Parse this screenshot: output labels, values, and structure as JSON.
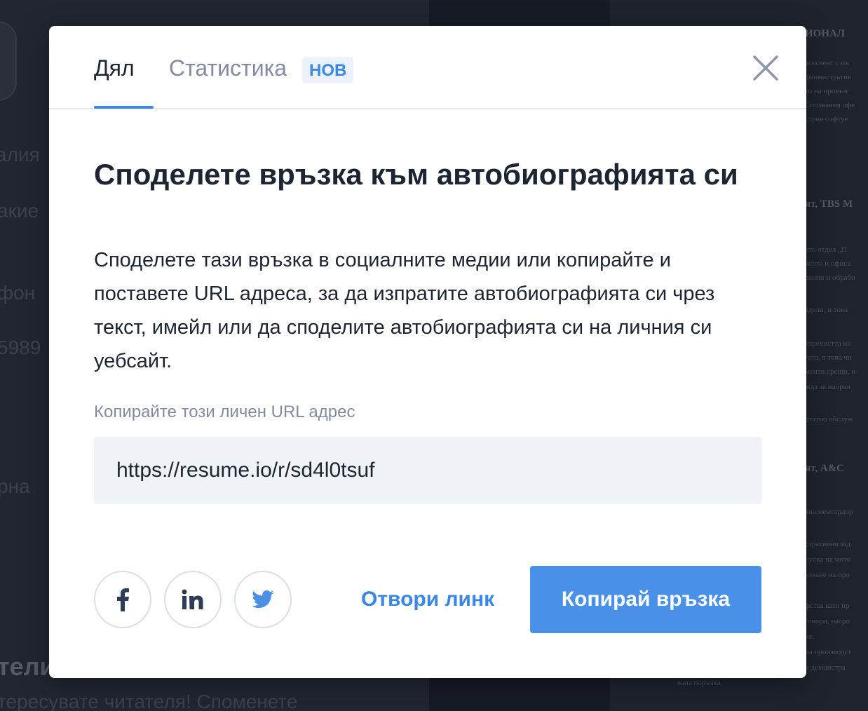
{
  "background": {
    "left_texts": [
      "алия",
      "акие",
      "фон",
      "5989",
      "рна",
      "тели",
      "тересувате читателя! Споменете"
    ],
    "doc_heads": [
      "ИОНАЛ",
      "ят, TBS M",
      "ят, A&C"
    ],
    "doc_lines": [
      "асистент с пъ",
      "дминистратив",
      "то на провъзг",
      "Сполвания офе",
      "стрия софтуе",
      "ото отдел „П",
      "всото и офиса",
      "ванни и обрабо",
      "адели, и това",
      "изреността на",
      "гата, в това чи",
      "менти срещи, и",
      "жда за направ",
      "лтатно обслуж",
      "яна ментордор",
      "стративни зад",
      "пуска на мото",
      "ъзване на про",
      "фства като пр",
      "говори, насро",
      "ие.",
      "на производст",
      "и демонстра",
      "",
      "вана поръчка."
    ]
  },
  "tabs": {
    "share_label": "Дял",
    "stats_label": "Статистика",
    "new_badge": "НОВ"
  },
  "content": {
    "title": "Споделете връзка към автобиографията си",
    "description": "Споделете тази връзка в социалните медии или копирайте и поставете URL адреса, за да изпратите автобиографията си чрез текст, имейл или да споделите автобиографията си на личния си уебсайт.",
    "url_label": "Копирайте този личен URL адрес",
    "url_value": "https://resume.io/r/sd4l0tsuf"
  },
  "actions": {
    "open_link_label": "Отвори линк",
    "copy_link_label": "Копирай връзка"
  },
  "icons": {
    "facebook": "facebook-icon",
    "linkedin": "linkedin-icon",
    "twitter": "twitter-icon",
    "close": "close-icon"
  },
  "colors": {
    "accent": "#3a87e6",
    "button": "#4a90e8",
    "text": "#1e2532",
    "muted": "#828ba0"
  }
}
